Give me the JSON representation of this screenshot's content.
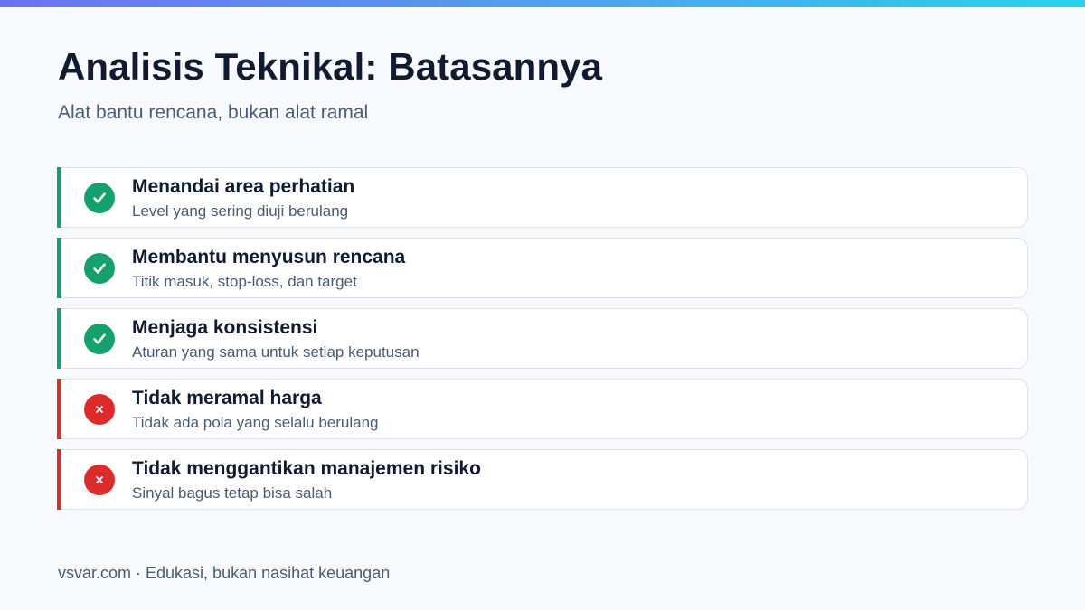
{
  "header": {
    "title": "Analisis Teknikal: Batasannya",
    "subtitle": "Alat bantu rencana, bukan alat ramal"
  },
  "items": [
    {
      "kind": "positive",
      "icon": "check-icon",
      "title": "Menandai area perhatian",
      "desc": "Level yang sering diuji berulang"
    },
    {
      "kind": "positive",
      "icon": "check-icon",
      "title": "Membantu menyusun rencana",
      "desc": "Titik masuk, stop-loss, dan target"
    },
    {
      "kind": "positive",
      "icon": "check-icon",
      "title": "Menjaga konsistensi",
      "desc": "Aturan yang sama untuk setiap keputusan"
    },
    {
      "kind": "negative",
      "icon": "cross-icon",
      "title": "Tidak meramal harga",
      "desc": "Tidak ada pola yang selalu berulang"
    },
    {
      "kind": "negative",
      "icon": "cross-icon",
      "title": "Tidak menggantikan manajemen risiko",
      "desc": "Sinyal bagus tetap bisa salah"
    }
  ],
  "footer": {
    "text": "vsvar.com · Edukasi, bukan nasihat keuangan"
  },
  "colors": {
    "positive": "#16a06b",
    "negative": "#dc2b2b",
    "gradient_start": "#6d72f2",
    "gradient_end": "#28d2ee"
  }
}
